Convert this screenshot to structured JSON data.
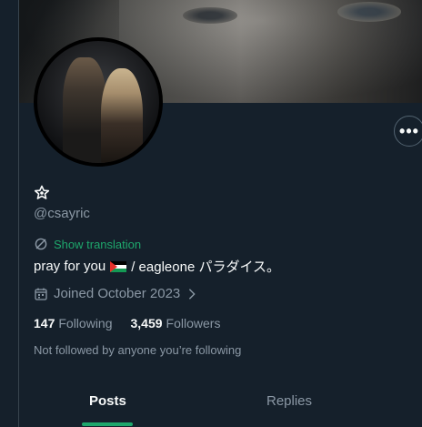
{
  "profile": {
    "handle": "@csayric",
    "show_translation": "Show translation",
    "bio_text": "pray for you",
    "bio_suffix": "/ eagleone パラダイス。",
    "joined": "Joined October 2023",
    "following_count": "147",
    "following_label": "Following",
    "followers_count": "3,459",
    "followers_label": "Followers",
    "not_followed": "Not followed by anyone you’re following",
    "more_icon": "more-horizontal-icon"
  },
  "tabs": [
    {
      "label": "Posts",
      "selected": true
    },
    {
      "label": "Replies",
      "selected": false
    }
  ],
  "colors": {
    "background": "#15202b",
    "accent": "#1ea76c",
    "muted_text": "#8b98a5",
    "primary_text": "#f7f9f9"
  }
}
